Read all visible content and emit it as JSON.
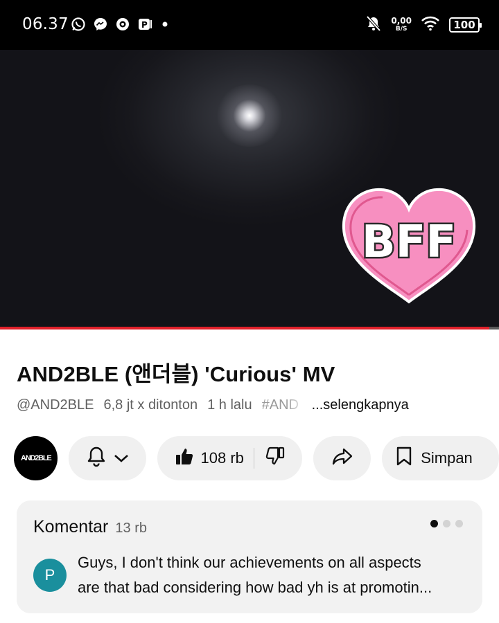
{
  "status_bar": {
    "time": "06.37",
    "left_icons": [
      "whatsapp-icon",
      "messenger-icon",
      "app-icon",
      "parking-app-icon",
      "notification-dot-icon"
    ],
    "net_speed_value": "0,00",
    "net_speed_unit": "B/S",
    "battery": "100"
  },
  "video": {
    "sticker_text": "BFF",
    "progress_fraction": 0.98,
    "colors": {
      "progress": "#e0202a",
      "sticker_pink": "#f78fc0"
    }
  },
  "video_info": {
    "title": "AND2BLE (앤더블) 'Curious' MV",
    "channel_handle": "@AND2BLE",
    "views": "6,8 jt x ditonton",
    "age": "1 h lalu",
    "hashtag": "#AND",
    "more_label": "...selengkapnya"
  },
  "actions": {
    "channel_avatar_text": "AND2BLE",
    "like_count": "108 rb",
    "save_label": "Simpan"
  },
  "comments": {
    "label": "Komentar",
    "count": "13 rb",
    "avatar_initial": "P",
    "avatar_color": "#1a8f9d",
    "line1": "Guys, I don't think our achievements on all aspects",
    "line2": "are that bad considering how bad yh is at promotin..."
  }
}
